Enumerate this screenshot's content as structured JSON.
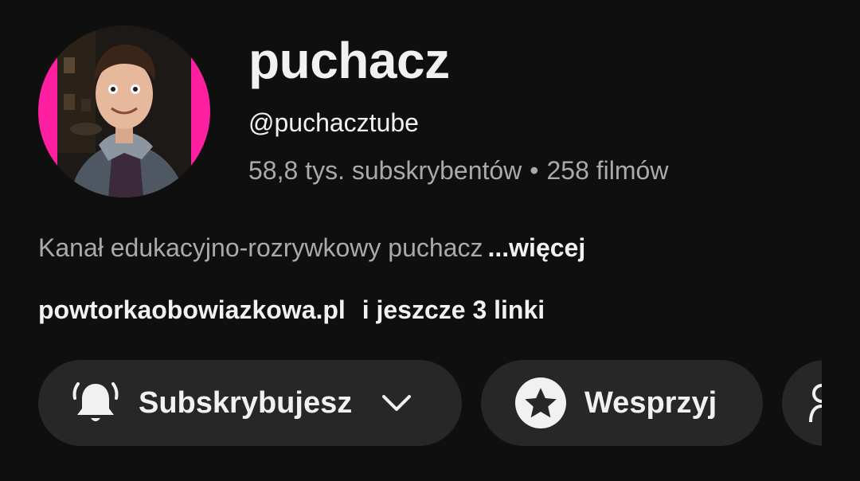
{
  "channel": {
    "name": "puchacz",
    "handle": "@puchacztube",
    "subscribers": "58,8 tys. subskrybentów",
    "stats_separator": "•",
    "videos": "258 filmów",
    "avatar": "avatar-photo"
  },
  "description": {
    "text": "Kanał edukacyjno-rozrywkowy puchacz",
    "more_label": "...więcej"
  },
  "links": {
    "primary": "powtorkaobowiazkowa.pl",
    "extra": "i jeszcze 3 linki"
  },
  "actions": {
    "subscribe_label": "Subskrybujesz",
    "subscribe_icon": "bell-icon",
    "dropdown_icon": "chevron-down-icon",
    "support_label": "Wesprzyj",
    "support_icon": "star-icon",
    "partial_icon": "person-icon"
  },
  "colors": {
    "background": "#0f0f0f",
    "button_bg": "#272727",
    "primary_text": "#f1f1f1",
    "secondary_text": "#aaaaaa",
    "avatar_accent": "#ff1fa0"
  }
}
